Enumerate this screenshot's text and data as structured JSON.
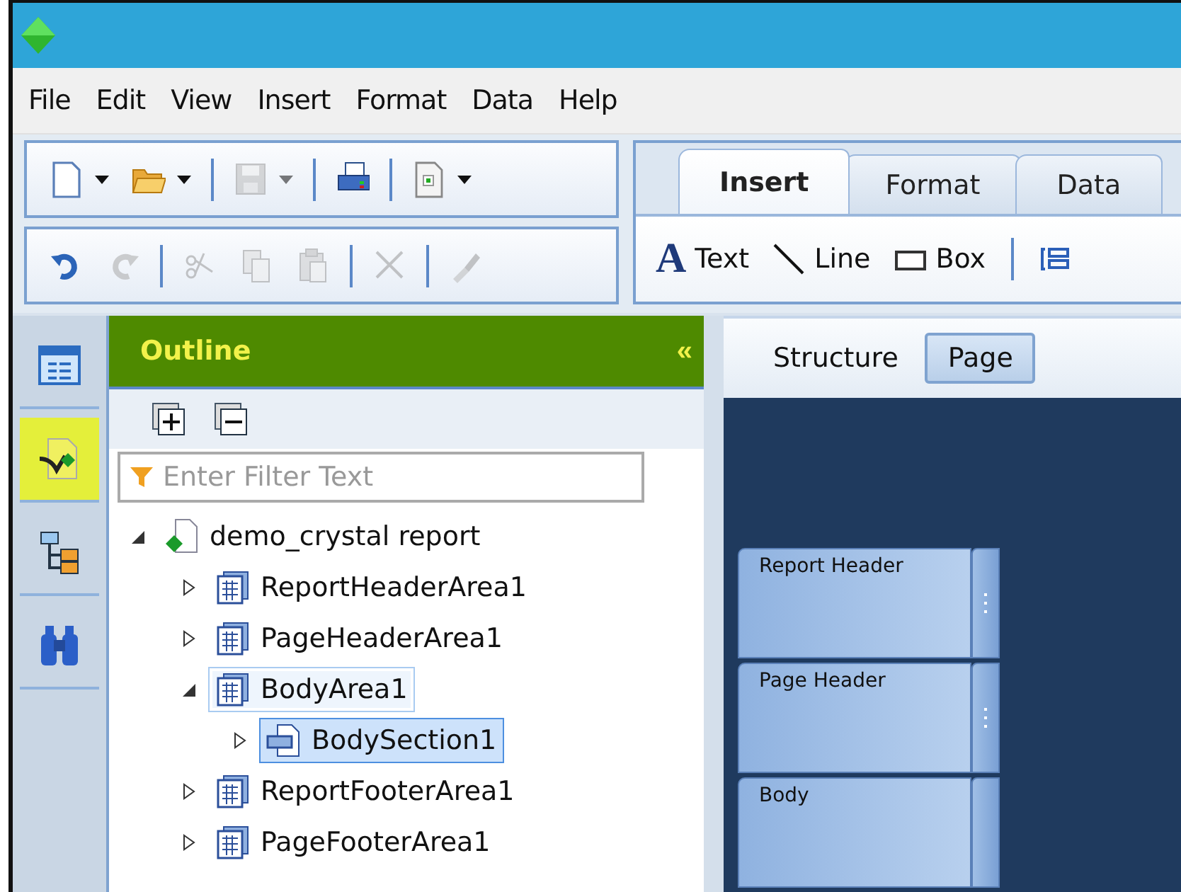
{
  "menu": [
    "File",
    "Edit",
    "View",
    "Insert",
    "Format",
    "Data",
    "Help"
  ],
  "toolbars": [
    [
      {
        "kind": "new",
        "dropdown": true,
        "disabled": false
      },
      {
        "kind": "open",
        "dropdown": true,
        "disabled": false
      },
      {
        "kind": "sep"
      },
      {
        "kind": "save",
        "dropdown": true,
        "disabled": true
      },
      {
        "kind": "sep"
      },
      {
        "kind": "print",
        "dropdown": false,
        "disabled": false
      },
      {
        "kind": "sep"
      },
      {
        "kind": "export",
        "dropdown": true,
        "disabled": false
      }
    ],
    [
      {
        "kind": "undo",
        "dropdown": false,
        "disabled": false
      },
      {
        "kind": "redo",
        "dropdown": false,
        "disabled": true
      },
      {
        "kind": "sep"
      },
      {
        "kind": "cut",
        "dropdown": false,
        "disabled": true
      },
      {
        "kind": "copy",
        "dropdown": false,
        "disabled": true
      },
      {
        "kind": "paste",
        "dropdown": false,
        "disabled": true
      },
      {
        "kind": "sep"
      },
      {
        "kind": "delete",
        "dropdown": false,
        "disabled": true
      },
      {
        "kind": "sep"
      },
      {
        "kind": "brush",
        "dropdown": false,
        "disabled": true
      }
    ]
  ],
  "ribbon": {
    "tabs": [
      {
        "label": "Insert",
        "selected": true
      },
      {
        "label": "Format",
        "selected": false
      },
      {
        "label": "Data",
        "selected": false
      }
    ],
    "items": [
      {
        "kind": "text",
        "glyph": "A",
        "label": "Text"
      },
      {
        "kind": "line",
        "label": "Line"
      },
      {
        "kind": "box",
        "label": "Box"
      },
      {
        "kind": "sep"
      },
      {
        "kind": "group"
      }
    ]
  },
  "sidebar": {
    "items": [
      {
        "kind": "layout",
        "selected": false
      },
      {
        "kind": "outline",
        "selected": true
      },
      {
        "kind": "tree",
        "selected": false
      },
      {
        "kind": "find",
        "selected": false
      }
    ]
  },
  "outline": {
    "title": "Outline",
    "collapse": "«",
    "filter": {
      "placeholder": "Enter Filter Text"
    },
    "tree": [
      {
        "label": "demo_crystal report",
        "kind": "report",
        "expanded": true,
        "selected": false,
        "hovered": false,
        "children": [
          {
            "label": "ReportHeaderArea1",
            "kind": "area",
            "expanded": false,
            "selected": false,
            "hovered": false
          },
          {
            "label": "PageHeaderArea1",
            "kind": "area",
            "expanded": false,
            "selected": false,
            "hovered": false
          },
          {
            "label": "BodyArea1",
            "kind": "area",
            "expanded": true,
            "selected": false,
            "hovered": true,
            "children": [
              {
                "label": "BodySection1",
                "kind": "section",
                "expanded": false,
                "selected": true,
                "hovered": false
              }
            ]
          },
          {
            "label": "ReportFooterArea1",
            "kind": "area",
            "expanded": false,
            "selected": false,
            "hovered": false
          },
          {
            "label": "PageFooterArea1",
            "kind": "area",
            "expanded": false,
            "selected": false,
            "hovered": false
          }
        ]
      }
    ]
  },
  "design": {
    "tabs": [
      {
        "label": "Structure",
        "selected": false
      },
      {
        "label": "Page",
        "selected": true
      }
    ],
    "sections": [
      {
        "label": "Report Header",
        "grip": true
      },
      {
        "label": "Page Header",
        "grip": true
      },
      {
        "label": "Body",
        "grip": false
      }
    ]
  }
}
